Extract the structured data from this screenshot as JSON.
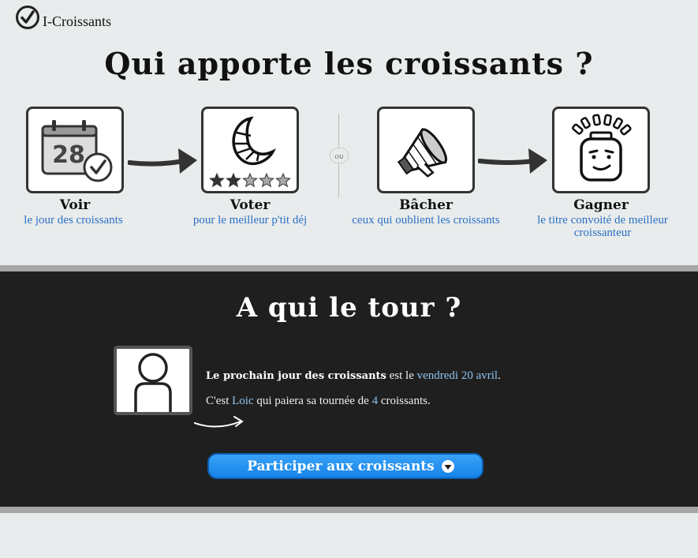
{
  "app": {
    "name": "I-Croissants"
  },
  "hero": {
    "title": "Qui apporte les croissants ?"
  },
  "steps": [
    {
      "title": "Voir",
      "subtitle": "le jour des croissants",
      "icon": "calendar-icon",
      "calendar_day": "28"
    },
    {
      "title": "Voter",
      "subtitle": "pour le meilleur p'tit déj",
      "icon": "croissant-icon",
      "rating": 2,
      "rating_max": 5
    },
    {
      "title": "Bâcher",
      "subtitle": "ceux qui oublient les croissants",
      "icon": "megaphone-icon"
    },
    {
      "title": "Gagner",
      "subtitle": "le titre convoité de meilleur croissanteur",
      "icon": "winner-head-icon"
    }
  ],
  "or_label": "ou",
  "turn": {
    "title": "A qui le tour ?",
    "next_label": "Le prochain jour des croissants",
    "next_mid": " est le ",
    "next_date": "vendredi 20 avril",
    "next_end": ".",
    "pay_prefix": "C'est ",
    "pay_name": "Loic",
    "pay_mid": " qui paiera sa tournée de ",
    "pay_count": "4",
    "pay_end": " croissants."
  },
  "cta": {
    "label": "Participer aux croissants",
    "icon": "chevron-down-circle-icon"
  },
  "colors": {
    "accent": "#1583e8",
    "link": "#2a6fc4",
    "dark_bg": "#1f1f1f",
    "highlight": "#8fc3ee"
  }
}
